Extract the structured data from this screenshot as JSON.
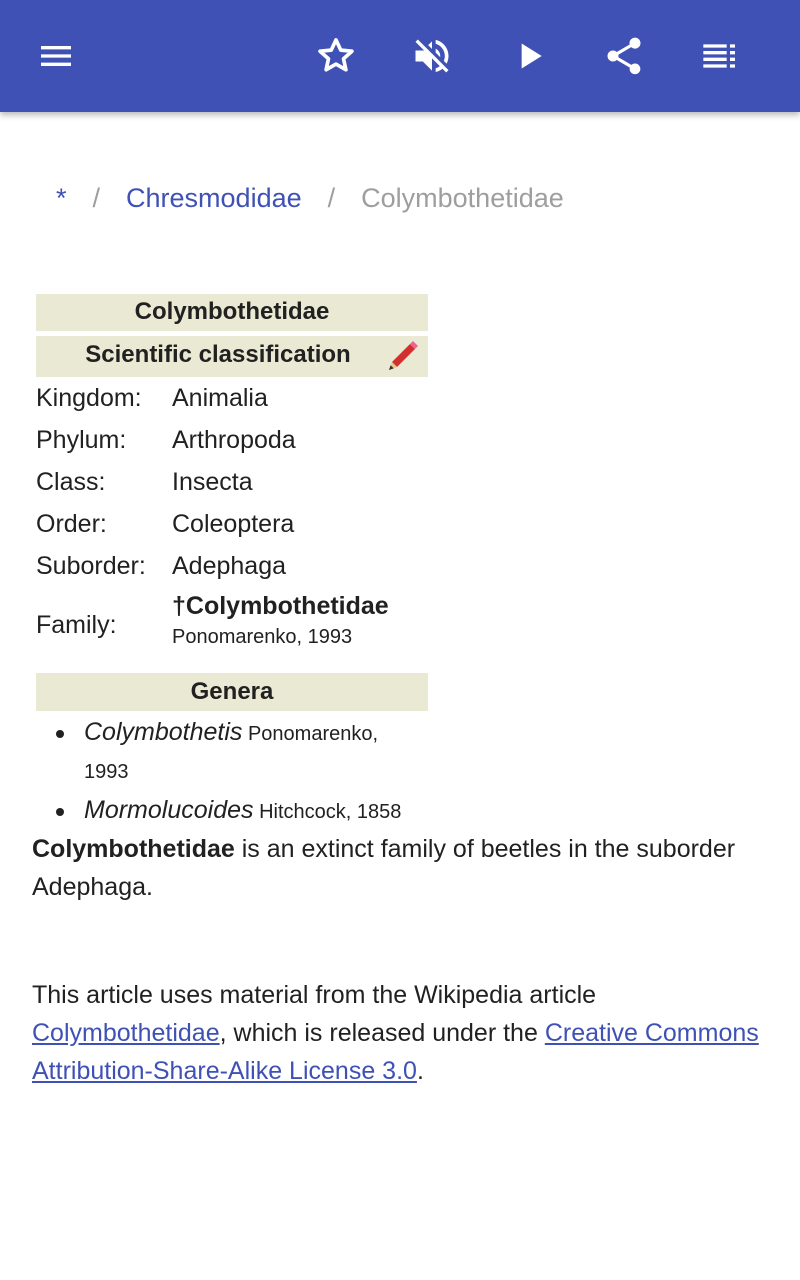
{
  "appbar": {
    "color": "#3f51b5",
    "icons": [
      "menu-icon",
      "star-icon",
      "volume-off-icon",
      "play-icon",
      "share-icon",
      "playlist-icon"
    ]
  },
  "breadcrumb": {
    "root": "*",
    "separator": "/",
    "parent": "Chresmodidae",
    "current": "Colymbothetidae"
  },
  "infobox": {
    "title": "Colymbothetidae",
    "classification_header": "Scientific classification",
    "ranks": [
      {
        "label": "Kingdom:",
        "value": "Animalia"
      },
      {
        "label": "Phylum:",
        "value": "Arthropoda"
      },
      {
        "label": "Class:",
        "value": "Insecta"
      },
      {
        "label": "Order:",
        "value": "Coleoptera"
      },
      {
        "label": "Suborder:",
        "value": "Adephaga"
      }
    ],
    "family": {
      "label": "Family:",
      "name": "†Colymbothetidae",
      "authority": "Ponomarenko, 1993"
    },
    "genera_header": "Genera",
    "genera": [
      {
        "name": "Colymbothetis",
        "authority": "Ponomarenko, 1993"
      },
      {
        "name": "Mormolucoides",
        "authority": "Hitchcock, 1858"
      }
    ]
  },
  "intro": {
    "subject": "Colymbothetidae",
    "text": " is an extinct family of beetles in the suborder Adephaga."
  },
  "attribution": {
    "prefix": "This article uses material from the Wikipedia article ",
    "article_link": "Colymbothetidae",
    "middle": ", which is released under the ",
    "license_link": "Creative Commons Attribution-Share-Alike License 3.0",
    "suffix": "."
  }
}
